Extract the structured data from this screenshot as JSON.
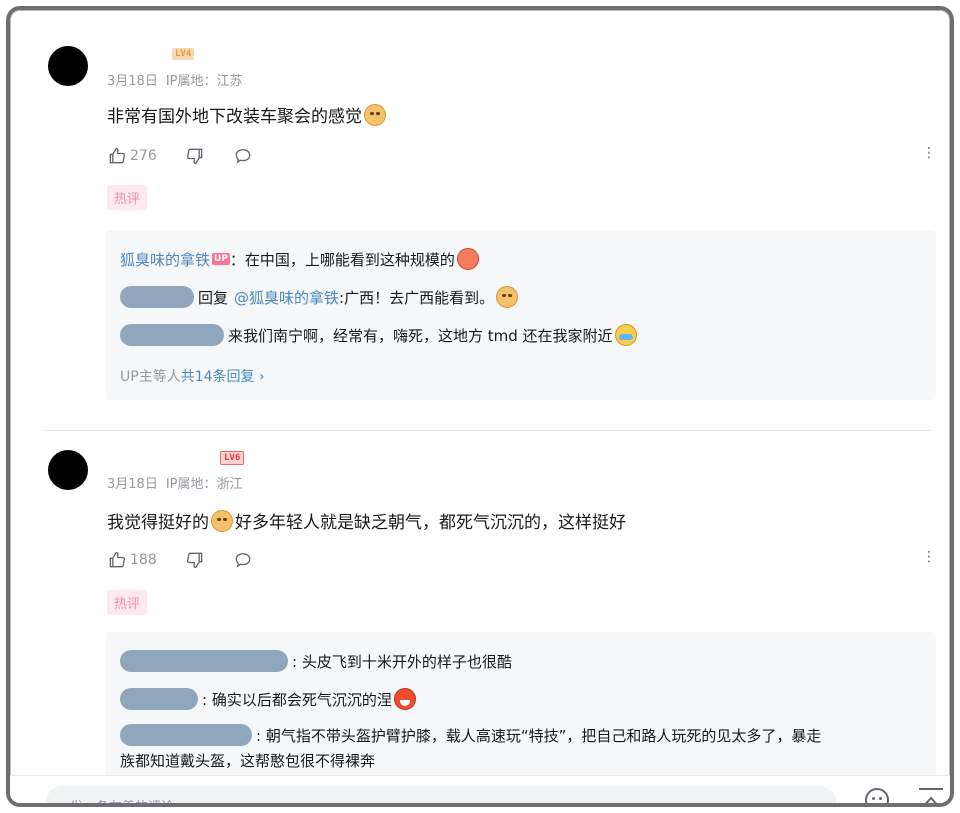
{
  "comments": [
    {
      "level": "LV4",
      "date": "3月18日",
      "ip": "IP属地：江苏",
      "text": "非常有国外地下改装车聚会的感觉",
      "likes": "276",
      "hot_tag": "热评",
      "replies": [
        {
          "user": "狐臭味的拿铁",
          "badge": "UP",
          "text": "：在中国，上哪能看到这种规模的"
        },
        {
          "reply_word": "回复",
          "mention": "@狐臭味的拿铁",
          "text": ":广西！去广西能看到。"
        },
        {
          "text": "来我们南宁啊，经常有，嗨死，这地方 tmd 还在我家附近"
        }
      ],
      "more_prefix": "UP主等人",
      "more_link": "共14条回复 ›"
    },
    {
      "level": "LV6",
      "date": "3月18日",
      "ip": "IP属地：浙江",
      "text_a": "我觉得挺好的",
      "text_b": "好多年轻人就是缺乏朝气，都死气沉沉的，这样挺好",
      "likes": "188",
      "hot_tag": "热评",
      "replies": [
        {
          "text": ": 头皮飞到十米开外的样子也很酷"
        },
        {
          "text": ": 确实以后都会死气沉沉的涅"
        },
        {
          "text": ": 朝气指不带头盔护臂护膝，载人高速玩“特技”，把自己和路人玩死的见太多了，暴走",
          "text2": "族都知道戴头盔，这帮憨包很不得裸奔"
        }
      ]
    }
  ],
  "bottom": {
    "placeholder": "发一条友善的评论"
  },
  "icons": [
    "like-icon",
    "dislike-icon",
    "reply-icon",
    "more-icon",
    "emoji-icon",
    "back-to-top-icon"
  ]
}
